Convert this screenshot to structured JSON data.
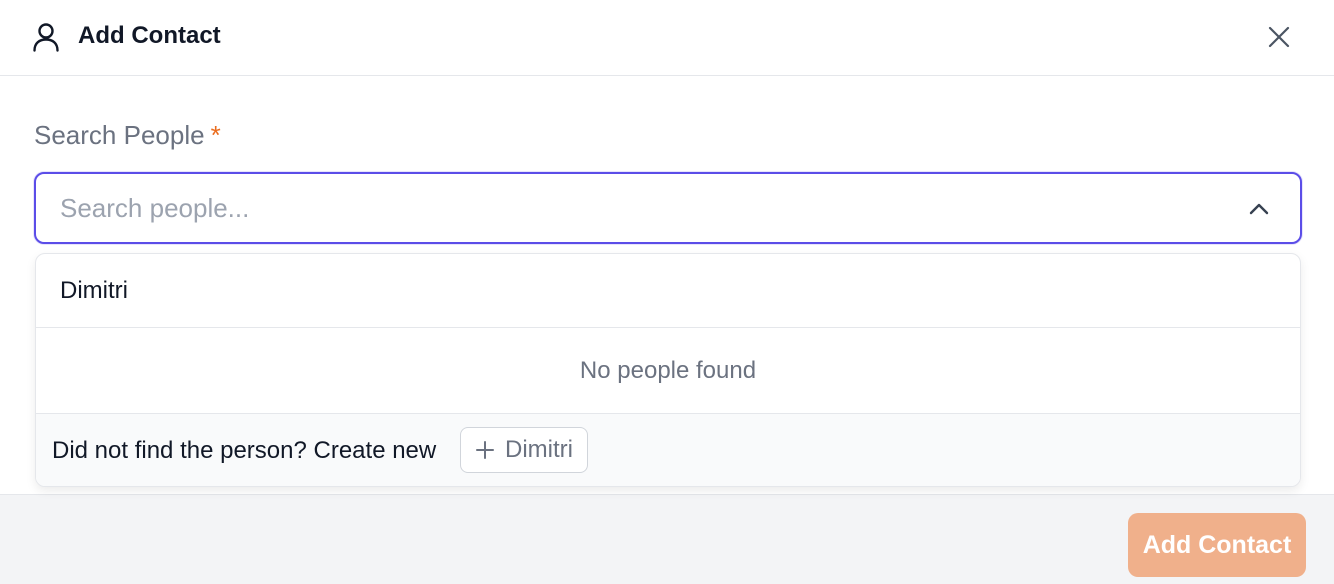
{
  "header": {
    "title": "Add Contact",
    "icon": "user-icon",
    "close_icon": "close-icon"
  },
  "form": {
    "label": "Search People",
    "required_marker": "*",
    "search_placeholder": "Search people...",
    "search_value": ""
  },
  "dropdown": {
    "typed_value": "Dimitri",
    "empty_message": "No people found",
    "create_prompt": "Did not find the person? Create new",
    "create_button_label": "Dimitri"
  },
  "footer": {
    "submit_label": "Add Contact"
  },
  "colors": {
    "accent": "#5b4de8",
    "required": "#ea6c1e",
    "submit_disabled": "#f0b08b"
  }
}
